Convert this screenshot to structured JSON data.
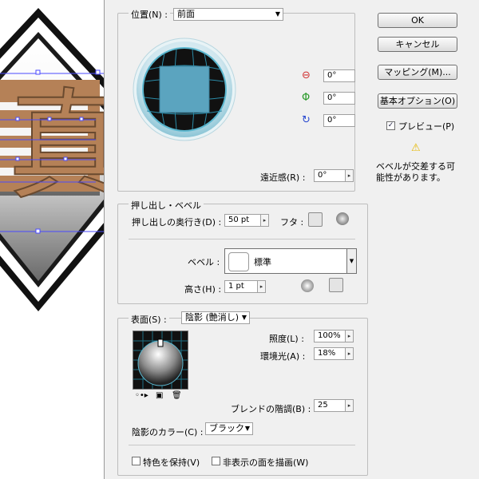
{
  "canvas": {
    "glyph": "真"
  },
  "position": {
    "label": "位置(N) :",
    "value": "前面",
    "perspective_label": "遠近感(R) :",
    "perspective_value": "0°",
    "rotations": [
      {
        "icon": "rotate-x-icon",
        "value": "0°"
      },
      {
        "icon": "rotate-y-icon",
        "value": "0°"
      },
      {
        "icon": "rotate-z-icon",
        "value": "0°"
      }
    ]
  },
  "buttons": {
    "ok": "OK",
    "cancel": "キャンセル",
    "mapping": "マッピング(M)...",
    "basic_options": "基本オプション(O)"
  },
  "preview": {
    "label": "プレビュー(P)",
    "checked": true
  },
  "warning": {
    "text1": "ベベルが交差する可",
    "text2": "能性があります。"
  },
  "extrude": {
    "title": "押し出し・ベベル",
    "depth_label": "押し出しの奥行き(D) :",
    "depth_value": "50 pt",
    "cap_label": "フタ :",
    "bevel_label": "ベベル :",
    "bevel_value": "標準",
    "height_label": "高さ(H) :",
    "height_value": "1 pt"
  },
  "surface": {
    "label": "表面(S) :",
    "value": "陰影 (艶消し)",
    "light_intensity_label": "照度(L) :",
    "light_intensity_value": "100%",
    "ambient_label": "環境光(A) :",
    "ambient_value": "18%",
    "blend_steps_label": "ブレンドの階調(B) :",
    "blend_steps_value": "25",
    "shading_color_label": "陰影のカラー(C) :",
    "shading_color_value": "ブラック",
    "preserve_spot_label": "特色を保持(V)",
    "draw_hidden_label": "非表示の面を描画(W)"
  },
  "colors": {
    "accent": "#55a3be",
    "glyph": "#b58157",
    "selection": "#4a4aff"
  }
}
